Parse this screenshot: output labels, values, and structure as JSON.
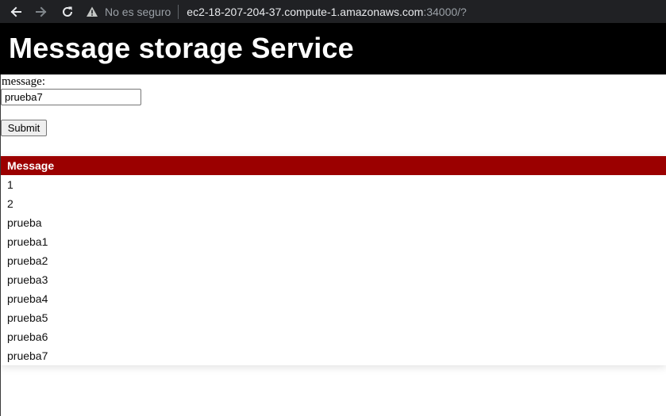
{
  "browser": {
    "security_label": "No es seguro",
    "url_host": "ec2-18-207-204-37.compute-1.amazonaws.com",
    "url_rest": ":34000/?",
    "icons": [
      "back-arrow-icon",
      "forward-arrow-icon",
      "reload-icon",
      "warning-icon"
    ]
  },
  "header": {
    "title": "Message storage Service",
    "background": "#000000"
  },
  "form": {
    "label": "message:",
    "input_value": "prueba7",
    "submit_label": "Submit"
  },
  "table": {
    "header": "Message",
    "header_color": "#9b0000",
    "rows": [
      "1",
      "2",
      "prueba",
      "prueba1",
      "prueba2",
      "prueba3",
      "prueba4",
      "prueba5",
      "prueba6",
      "prueba7"
    ]
  }
}
